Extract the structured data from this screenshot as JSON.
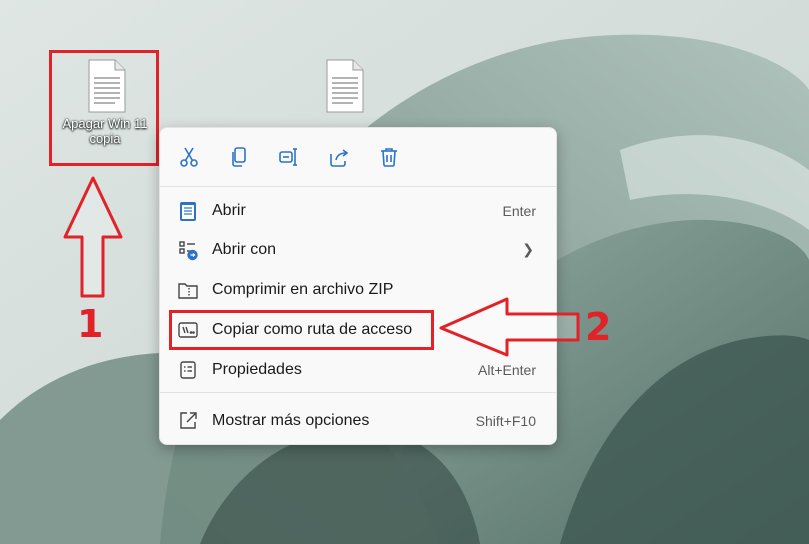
{
  "desktop": {
    "icons": [
      {
        "label_line1": "Apagar Win 11",
        "label_line2": "copia"
      }
    ]
  },
  "context_menu": {
    "toolbar": [
      {
        "icon": "cut-icon"
      },
      {
        "icon": "copy-icon"
      },
      {
        "icon": "rename-icon"
      },
      {
        "icon": "share-icon"
      },
      {
        "icon": "delete-icon"
      }
    ],
    "items": [
      {
        "icon": "notepad-icon",
        "label": "Abrir",
        "shortcut": "Enter"
      },
      {
        "icon": "open-with-icon",
        "label": "Abrir con",
        "shortcut": ""
      },
      {
        "icon": "zip-icon",
        "label": "Comprimir en archivo ZIP",
        "shortcut": ""
      },
      {
        "icon": "copy-path-icon",
        "label": "Copiar como ruta de acceso",
        "shortcut": ""
      },
      {
        "icon": "properties-icon",
        "label": "Propiedades",
        "shortcut": "Alt+Enter"
      },
      {
        "icon": "more-options-icon",
        "label": "Mostrar más opciones",
        "shortcut": "Shift+F10"
      }
    ]
  },
  "annotations": {
    "step1": "1",
    "step2": "2"
  },
  "colors": {
    "annotation_red": "#e12228",
    "menu_bg": "#f9f9f9",
    "icon_blue": "#2b73c9"
  }
}
